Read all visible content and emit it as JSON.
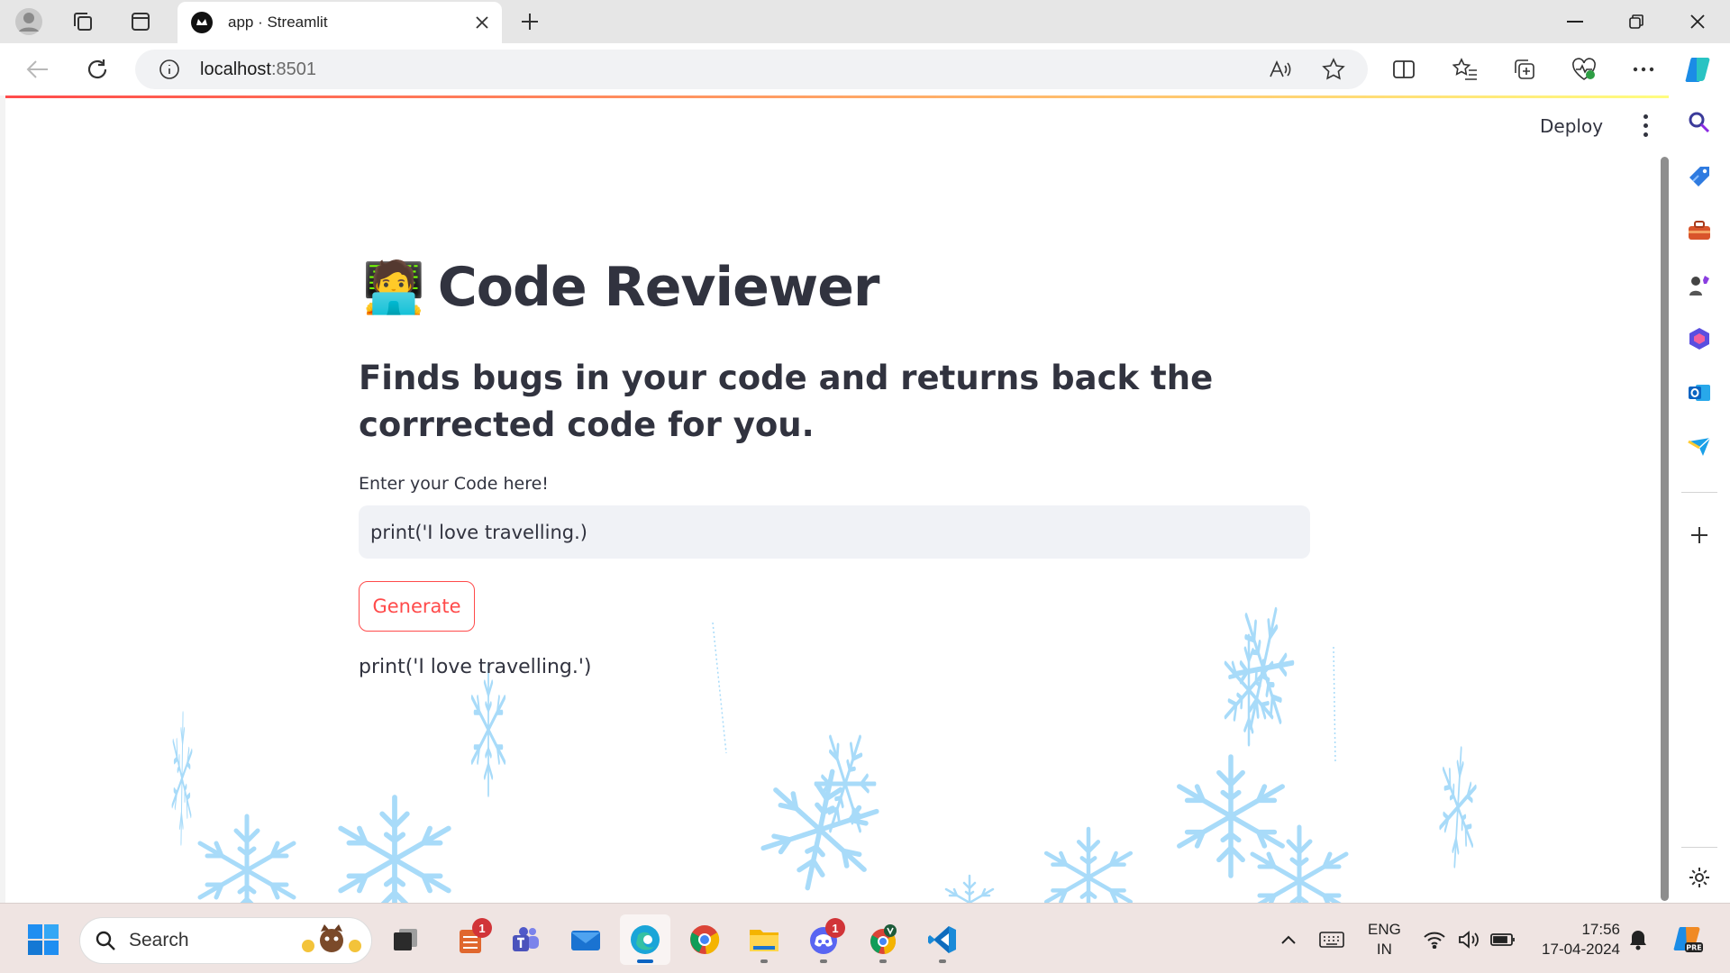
{
  "browser": {
    "tab_title": "app · Streamlit",
    "address": {
      "host": "localhost",
      "port": ":8501"
    }
  },
  "streamlit": {
    "deploy_label": "Deploy",
    "title": "Code Reviewer",
    "title_emoji": "🧑‍💻",
    "subtitle": "Finds bugs in your code and returns back the corrrected code for you.",
    "input_label": "Enter your Code here!",
    "input_value": "print('I love travelling.)",
    "button_label": "Generate",
    "result": "print('I love travelling.')"
  },
  "taskbar": {
    "search_label": "Search",
    "apps": [
      {
        "name": "task-view",
        "badge": ""
      },
      {
        "name": "app-ranking",
        "badge": "1"
      },
      {
        "name": "teams",
        "badge": ""
      },
      {
        "name": "mail",
        "badge": ""
      },
      {
        "name": "edge",
        "badge": ""
      },
      {
        "name": "chrome",
        "badge": ""
      },
      {
        "name": "file-explorer",
        "badge": ""
      },
      {
        "name": "discord",
        "badge": "1"
      },
      {
        "name": "chrome-profile",
        "badge": ""
      },
      {
        "name": "vscode",
        "badge": ""
      }
    ],
    "lang_line1": "ENG",
    "lang_line2": "IN",
    "time": "17:56",
    "date": "17-04-2024"
  },
  "colors": {
    "accent": "#ff4b4b",
    "text": "#31333f",
    "input_bg": "#f0f2f6",
    "snow": "#a8dbf9"
  }
}
